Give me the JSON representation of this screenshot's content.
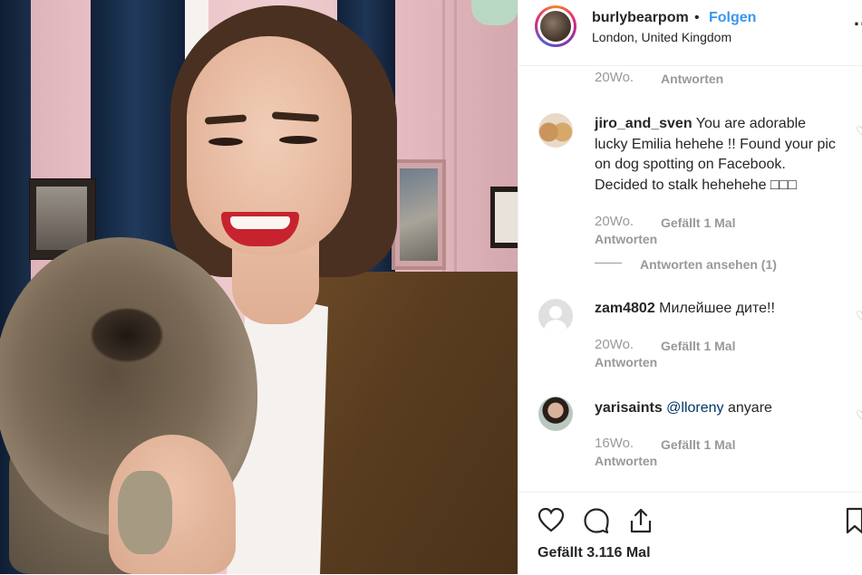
{
  "header": {
    "username": "burlybearpom",
    "separator": "•",
    "follow_label": "Folgen",
    "location": "London, United Kingdom",
    "more_icon": "…"
  },
  "comments": {
    "prev": {
      "time": "20Wo.",
      "reply_label": "Antworten"
    },
    "items": [
      {
        "username": "jiro_and_sven",
        "text": "You are adorable lucky Emilia hehehe !! Found your pic on dog spotting on Facebook. Decided to stalk hehehehe □□□",
        "time": "20Wo.",
        "likes_label": "Gefällt 1 Mal",
        "reply_label": "Antworten",
        "view_replies_label": "Antworten ansehen (1)"
      },
      {
        "username": "zam4802",
        "text": "Милейшее дите!!",
        "time": "20Wo.",
        "likes_label": "Gefällt 1 Mal",
        "reply_label": "Antworten"
      },
      {
        "username": "yarisaints",
        "mention": "@lloreny",
        "text": "anyare",
        "time": "16Wo.",
        "likes_label": "Gefällt 1 Mal",
        "reply_label": "Antworten"
      }
    ]
  },
  "actions": {
    "like_icon": "heart-icon",
    "comment_icon": "comment-icon",
    "share_icon": "share-icon",
    "save_icon": "bookmark-icon",
    "likes_count_label": "Gefällt 3.116 Mal"
  },
  "colors": {
    "link_blue": "#3897f0",
    "text": "#262626",
    "muted": "#999999",
    "mention": "#003569"
  }
}
